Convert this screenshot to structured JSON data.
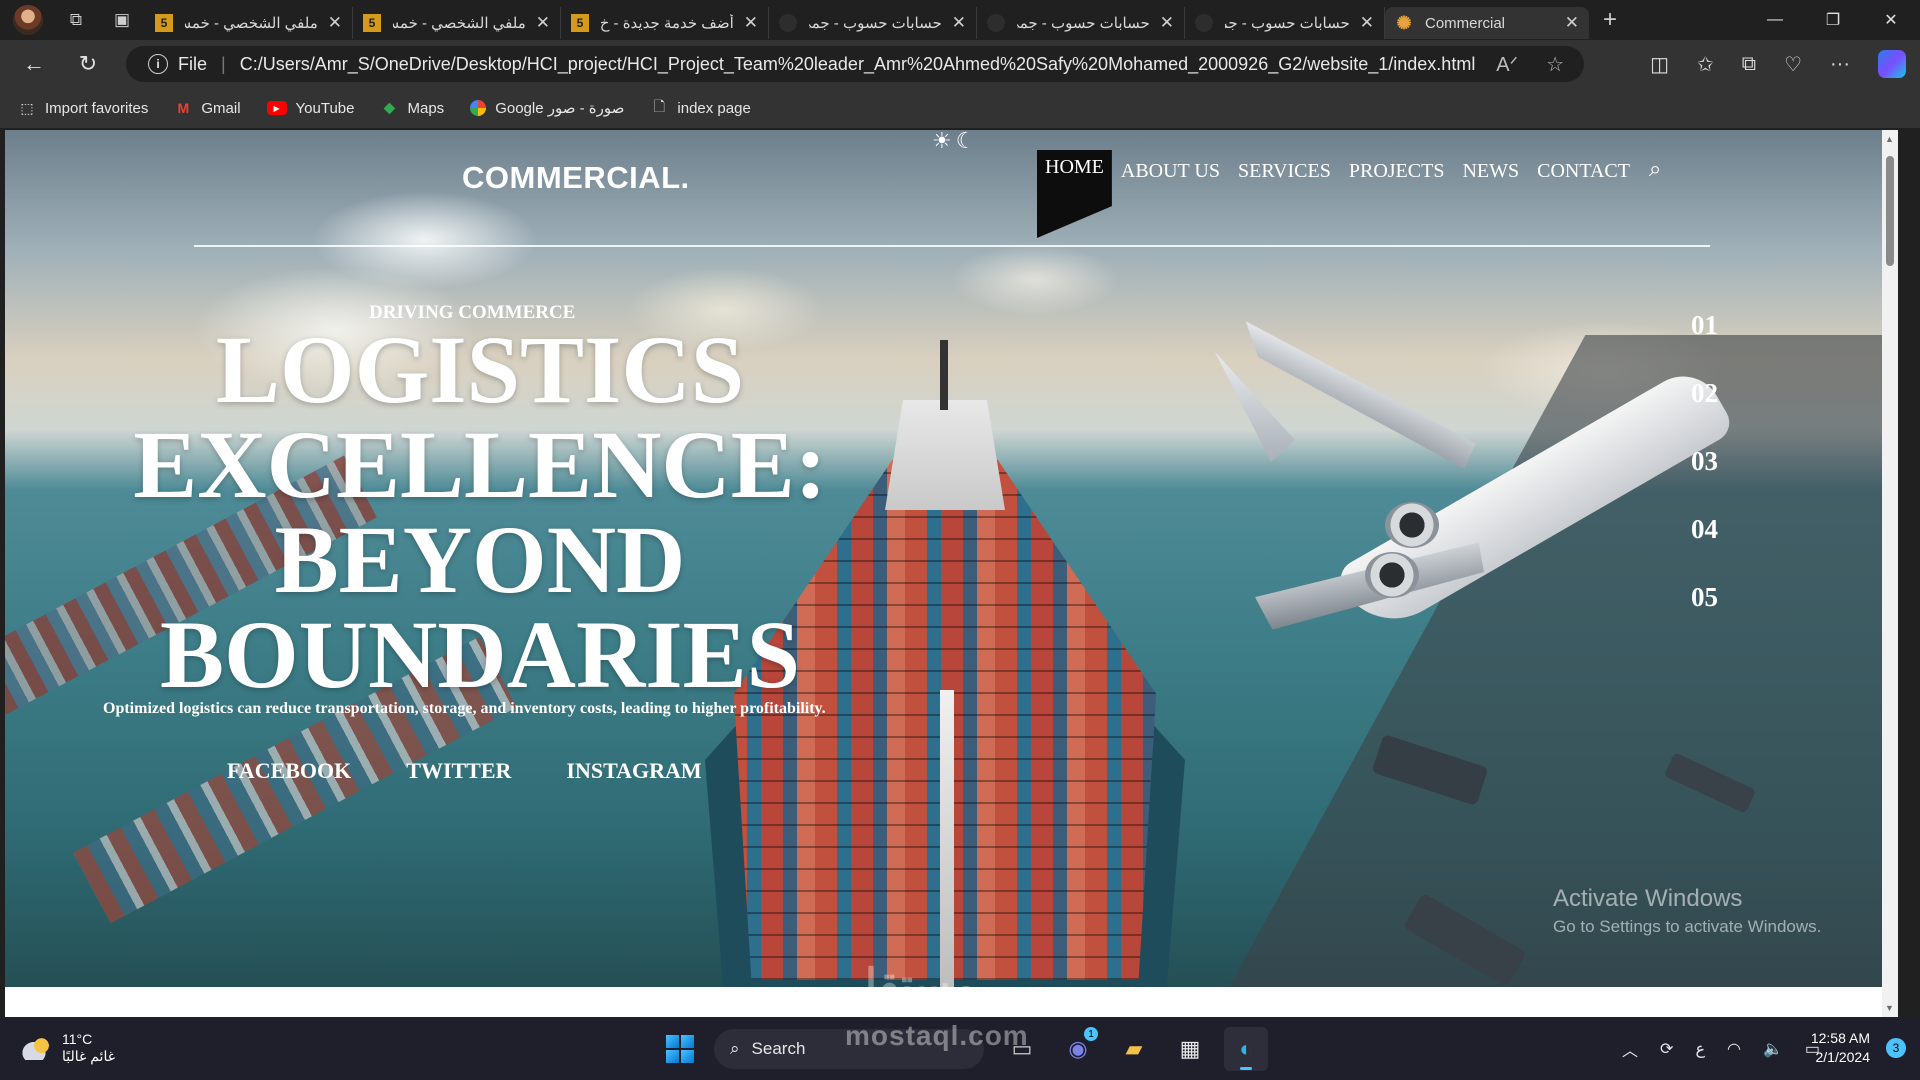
{
  "browser": {
    "tabs": [
      {
        "title": "ملفي الشخصي - خمس",
        "favicon": "5",
        "active": false
      },
      {
        "title": "ملفي الشخصي - خمس",
        "favicon": "5",
        "active": false
      },
      {
        "title": "أضف خدمة جديدة - خ",
        "favicon": "5",
        "active": false
      },
      {
        "title": "حسابات حسوب - جمي",
        "favicon": "",
        "active": false
      },
      {
        "title": "حسابات حسوب - جمي",
        "favicon": "",
        "active": false
      },
      {
        "title": "حسابات حسوب - جمي",
        "favicon": "",
        "active": false
      },
      {
        "title": "Commercial",
        "favicon": "logo",
        "active": true
      }
    ],
    "address": {
      "scheme_label": "File",
      "url": "C:/Users/Amr_S/OneDrive/Desktop/HCI_project/HCI_Project_Team%20leader_Amr%20Ahmed%20Safy%20Mohamed_2000926_G2/website_1/index.html"
    },
    "favorites": [
      {
        "label": "Import favorites",
        "icon": "import-icon"
      },
      {
        "label": "Gmail",
        "icon": "gmail-icon"
      },
      {
        "label": "YouTube",
        "icon": "youtube-icon"
      },
      {
        "label": "Maps",
        "icon": "maps-icon"
      },
      {
        "label": "Google صورة - صور",
        "icon": "photos-icon"
      },
      {
        "label": "index page",
        "icon": "page-icon"
      }
    ]
  },
  "site": {
    "logo": "COMMERCIAL.",
    "nav": [
      "HOME",
      "ABOUT US",
      "SERVICES",
      "PROJECTS",
      "NEWS",
      "CONTACT"
    ],
    "active_nav": "HOME",
    "kicker": "DRIVING COMMERCE",
    "headline_lines": [
      "LOGISTICS",
      "EXCELLENCE:",
      "BEYOND",
      "BOUNDARIES"
    ],
    "subline": "Optimized logistics can reduce transportation, storage, and inventory costs, leading to higher profitability.",
    "social": [
      "FACEBOOK",
      "TWITTER",
      "INSTAGRAM"
    ],
    "slides": [
      "01",
      "02",
      "03",
      "04",
      "05"
    ],
    "colors": {
      "nav_active_bg": "#0d0d0d",
      "text": "#ffffff"
    }
  },
  "watermark": {
    "line1": "Activate Windows",
    "line2": "Go to Settings to activate Windows."
  },
  "overlay_brand": {
    "arabic": "مستقل",
    "latin": "mostaql.com"
  },
  "taskbar": {
    "weather_temp": "11°C",
    "weather_desc": "غائم غالبًا",
    "search_label": "Search",
    "teams_badge": "1",
    "ime_label": "ع",
    "time": "12:58 AM",
    "date": "2/1/2024",
    "notifications": "3"
  }
}
